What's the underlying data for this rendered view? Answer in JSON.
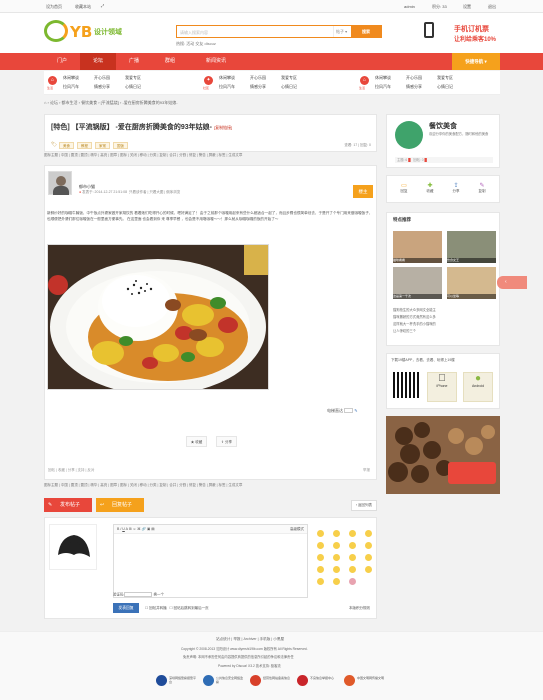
{
  "topbar": {
    "left": [
      "设为首页",
      "收藏本站"
    ],
    "user": "admin",
    "points": "积分: 33",
    "settings": "设置",
    "logout": "退出"
  },
  "logo": {
    "brand": "YB",
    "name": "设计领域"
  },
  "search": {
    "placeholder": "请输入搜索内容",
    "scope": "帖子",
    "button": "搜索",
    "hot_label": "热搜:",
    "hot": [
      "活动",
      "交友",
      "discuz"
    ]
  },
  "phone": {
    "line1": "手机订机票",
    "line2": "让利给乘客10%"
  },
  "nav": {
    "items": [
      "门户",
      "论坛",
      "广播",
      "群组",
      "新闻资讯"
    ],
    "quick": "快捷导航"
  },
  "subnav": {
    "groups": [
      {
        "label": "生活",
        "items": [
          "休闲攀谈",
          "开心乐园",
          "我爱专区",
          "拉风汽车",
          "情感分享",
          "心情日记"
        ]
      },
      {
        "label": "社区",
        "items": [
          "休闲攀谈",
          "开心乐园",
          "我爱专区",
          "拉风汽车",
          "情感分享",
          "心情日记"
        ]
      },
      {
        "label": "生活",
        "items": [
          "休闲攀谈",
          "开心乐园",
          "我爱专区",
          "拉风汽车",
          "情感分享",
          "心情日记"
        ]
      }
    ]
  },
  "breadcrumb": [
    "首页",
    "论坛",
    "都市生活",
    "餐饮美食",
    "[平流猛烧]",
    "-爱在厨房折腾美食的93年姑娘-"
  ],
  "thread": {
    "title": "[特色] 【平流锅版】 -爱在厨房折腾美食的93年姑娘-",
    "copy_link": "[复制链接]",
    "views": "查看: 17",
    "replies": "回复: 0",
    "tags": [
      "美食",
      "教程",
      "家常",
      "国饭"
    ],
    "toolbar": "图标主题 | 中国 | 置顶 | 置顶 | 精华 | 高亮 | 图章 | 图标 | 关闭 | 移动 | 分类 | 复制 | 合并 | 分割 | 修复 | 警告 | 屏蔽 | 标签 | 生成文章",
    "author": "郁市小猫",
    "post_time": "发表于: 2014-12-27 21:51:08",
    "view_options": "只看该作者 | 只看大图 | 倒序浏览",
    "floor": "楼主",
    "body": "新鲜炒好的咖喱牛腩饭，中午饭点外婆家做开家胡饮的 看着她们吃得开心的时候，嗯好满足了！ 由于之前那个咖喱用起来有些什么都适合一起了，而且步骤也很简单划去，于是开了个专门用来做咖喱饭子，也顺便把外婆们那位咖喱饭在一般里面方便事先。 在这里面 也会看到你 来 尊享早餐 ，也会是不用咯咖喱～～！那么就从咖喱咖喱的饭的开始了～",
    "edit_status": "电梯直达",
    "collect": "收藏",
    "share": "分享",
    "rating_row": "回帖 | 收藏 | 分享 | 支持 | 反对"
  },
  "sidebar": {
    "forum_name": "餐饮美食",
    "forum_desc": "欢迎分享你的美食配方，随时和他的美食",
    "stats": [
      "主题: 6",
      "回帖: 0"
    ],
    "actions": [
      "回复",
      "收藏",
      "分享",
      "复制"
    ],
    "featured_title": "特点推荐",
    "featured_caps": [
      "猫咪看看",
      "饮食女王",
      "这是第一千次",
      "可以坐等"
    ],
    "featured_links": [
      "猫狗抢生的大众多网文全能主",
      "猫咪撒娇的方式竟然有这么多",
      "这样就大一杯洗手的小猫咪的",
      "让人惊叹的三个"
    ],
    "app_title": "下载19楼APP，去看、去看、玩得上19楼",
    "app_iphone": "iPhone",
    "app_android": "Android"
  },
  "reply": {
    "tab_post": "发布帖子",
    "tab_reply": "回复帖子",
    "back": "返回列表",
    "advanced": "高级模式",
    "code_label": "验证码",
    "refresh": "换一个",
    "submit": "发表回复",
    "opt1": "回帖并转播",
    "opt2": "回帖后跳转到最后一页",
    "rules": "本版积分规则"
  },
  "footer": {
    "links": [
      "站点统计",
      "举报",
      "Archiver",
      "手机版",
      "小黑屋"
    ],
    "copyright": "Copyright © 2008-2013 沈阳设计 www.diyershi19lb.com 版权所有 All Rights Reserved.",
    "notice": "免责声明: 本网不承担任何由内容提供商提供的信息所引起的争议和法律责任",
    "powered": "Powered by Discuz! X3.2 技术支持: 极客流",
    "badges": [
      "深圳网络警察报警平台",
      "公共信息安全网络监察",
      "经营性网站备案信息",
      "不良信息举报中心",
      "中国文明网传播文明"
    ]
  }
}
